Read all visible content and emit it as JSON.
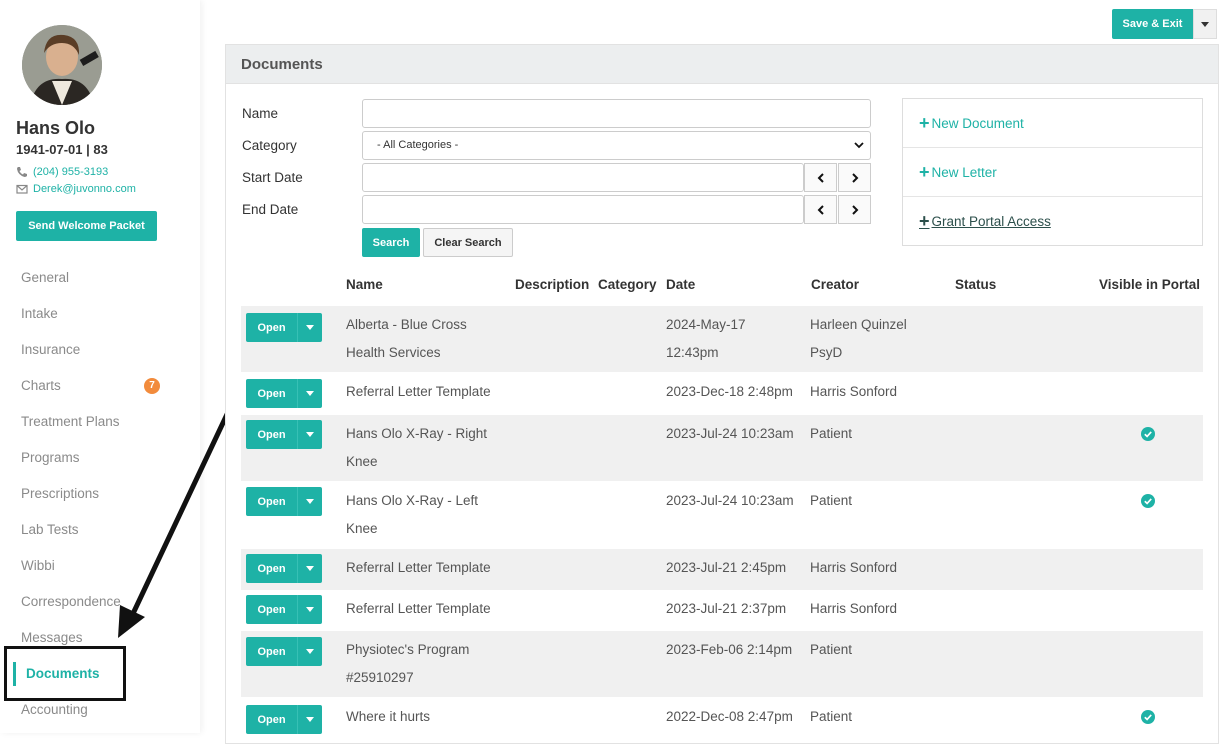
{
  "patient": {
    "name": "Hans Olo",
    "dob_age": "1941-07-01 | 83",
    "phone": "(204) 955-3193",
    "email": "Derek@juvonno.com",
    "welcome_button": "Send Welcome Packet"
  },
  "sidebar": {
    "items": [
      {
        "label": "General"
      },
      {
        "label": "Intake"
      },
      {
        "label": "Insurance"
      },
      {
        "label": "Charts",
        "badge": "7"
      },
      {
        "label": "Treatment Plans"
      },
      {
        "label": "Programs"
      },
      {
        "label": "Prescriptions"
      },
      {
        "label": "Lab Tests"
      },
      {
        "label": "Wibbi"
      },
      {
        "label": "Correspondence"
      },
      {
        "label": "Messages"
      },
      {
        "label": "Documents",
        "active": true
      },
      {
        "label": "Accounting"
      }
    ]
  },
  "toolbar": {
    "save_exit": "Save & Exit"
  },
  "panel": {
    "title": "Documents"
  },
  "filters": {
    "name_label": "Name",
    "category_label": "Category",
    "category_value": "- All Categories -",
    "start_label": "Start Date",
    "end_label": "End Date",
    "search": "Search",
    "clear": "Clear Search"
  },
  "actions": {
    "new_document": "New Document",
    "new_letter": "New Letter",
    "grant_portal": "Grant Portal Access"
  },
  "table": {
    "headers": {
      "name": "Name",
      "description": "Description",
      "category": "Category",
      "date": "Date",
      "creator": "Creator",
      "status": "Status",
      "visible": "Visible in Portal"
    },
    "open_label": "Open",
    "rows": [
      {
        "name1": "Alberta - Blue Cross",
        "name2": "Health Services",
        "date1": "2024-May-17",
        "date2": "12:43pm",
        "creator1": "Harleen Quinzel",
        "creator2": "PsyD",
        "visible": false
      },
      {
        "name1": "Referral Letter Template",
        "name2": "",
        "date1": "2023-Dec-18 2:48pm",
        "date2": "",
        "creator1": "Harris Sonford",
        "creator2": "",
        "visible": false
      },
      {
        "name1": "Hans Olo X-Ray - Right",
        "name2": "Knee",
        "date1": "2023-Jul-24 10:23am",
        "date2": "",
        "creator1": "Patient",
        "creator2": "",
        "visible": true
      },
      {
        "name1": "Hans Olo X-Ray - Left",
        "name2": "Knee",
        "date1": "2023-Jul-24 10:23am",
        "date2": "",
        "creator1": "Patient",
        "creator2": "",
        "visible": true
      },
      {
        "name1": "Referral Letter Template",
        "name2": "",
        "date1": "2023-Jul-21 2:45pm",
        "date2": "",
        "creator1": "Harris Sonford",
        "creator2": "",
        "visible": false
      },
      {
        "name1": "Referral Letter Template",
        "name2": "",
        "date1": "2023-Jul-21 2:37pm",
        "date2": "",
        "creator1": "Harris Sonford",
        "creator2": "",
        "visible": false
      },
      {
        "name1": "Physiotec's Program",
        "name2": "#25910297",
        "date1": "2023-Feb-06 2:14pm",
        "date2": "",
        "creator1": "Patient",
        "creator2": "",
        "visible": false
      },
      {
        "name1": "Where it hurts",
        "name2": "",
        "date1": "2022-Dec-08 2:47pm",
        "date2": "",
        "creator1": "Patient",
        "creator2": "",
        "visible": true
      }
    ]
  },
  "colors": {
    "accent": "#1eb2a6",
    "badge": "#f28b3c"
  }
}
